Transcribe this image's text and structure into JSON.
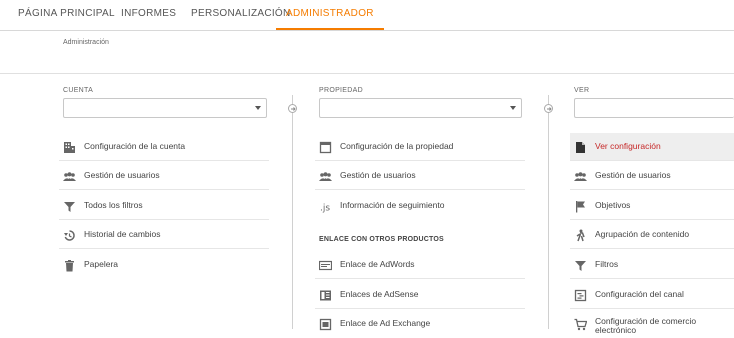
{
  "nav": {
    "tabs": [
      {
        "label": "PÁGINA PRINCIPAL"
      },
      {
        "label": "INFORMES"
      },
      {
        "label": "PERSONALIZACIÓN"
      },
      {
        "label": "ADMINISTRADOR"
      }
    ],
    "active_tab": "ADMINISTRADOR"
  },
  "breadcrumb": "Administración",
  "colors": {
    "accent": "#f57c00",
    "selected_text": "#c62828"
  },
  "columns": {
    "cuenta": {
      "title": "CUENTA",
      "select_value": "",
      "items": [
        {
          "label": "Configuración de la cuenta",
          "icon": "building-icon"
        },
        {
          "label": "Gestión de usuarios",
          "icon": "users-icon"
        },
        {
          "label": "Todos los filtros",
          "icon": "filter-icon"
        },
        {
          "label": "Historial de cambios",
          "icon": "history-icon"
        },
        {
          "label": "Papelera",
          "icon": "trash-icon"
        }
      ]
    },
    "propiedad": {
      "title": "PROPIEDAD",
      "select_value": "",
      "items": [
        {
          "label": "Configuración de la propiedad",
          "icon": "window-icon"
        },
        {
          "label": "Gestión de usuarios",
          "icon": "users-icon"
        },
        {
          "label": "Información de seguimiento",
          "icon": "js-icon"
        }
      ],
      "section_label": "ENLACE CON OTROS PRODUCTOS",
      "links": [
        {
          "label": "Enlace de AdWords",
          "icon": "adwords-icon"
        },
        {
          "label": "Enlaces de AdSense",
          "icon": "adsense-icon"
        },
        {
          "label": "Enlace de Ad Exchange",
          "icon": "adexchange-icon"
        }
      ]
    },
    "ver": {
      "title": "VER",
      "select_value": "",
      "items": [
        {
          "label": "Ver configuración",
          "icon": "document-icon"
        },
        {
          "label": "Gestión de usuarios",
          "icon": "users-icon"
        },
        {
          "label": "Objetivos",
          "icon": "flag-icon"
        },
        {
          "label": "Agrupación de contenido",
          "icon": "person-walk-icon"
        },
        {
          "label": "Filtros",
          "icon": "filter-icon"
        },
        {
          "label": "Configuración del canal",
          "icon": "channel-icon"
        },
        {
          "label": "Configuración de comercio electrónico",
          "icon": "cart-icon"
        }
      ]
    }
  }
}
